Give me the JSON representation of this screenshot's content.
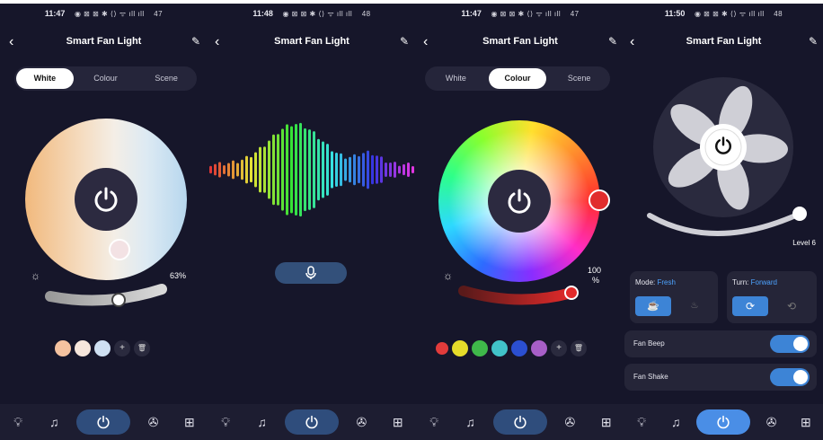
{
  "screens": [
    {
      "status_time": "11:47",
      "status_battery": "47",
      "title": "Smart Fan Light",
      "tabs": [
        "White",
        "Colour",
        "Scene"
      ],
      "active_tab": "White",
      "brightness_percent": "63%",
      "brightness_value": 0.63,
      "swatch_colors": [
        "#f4c2a0",
        "#f6e6dc",
        "#cfe0f2"
      ],
      "swatch_add": "+",
      "swatch_delete": "🗑"
    },
    {
      "status_time": "11:48",
      "status_battery": "48",
      "title": "Smart Fan Light",
      "mic_icon": "microphone-icon"
    },
    {
      "status_time": "11:47",
      "status_battery": "47",
      "title": "Smart Fan Light",
      "tabs": [
        "White",
        "Colour",
        "Scene"
      ],
      "active_tab": "Colour",
      "brightness_percent": "100",
      "brightness_unit": "%",
      "brightness_value": 1.0,
      "swatch_colors": [
        "#e23b3b",
        "#e6dc2a",
        "#3fb84a",
        "#41c3c9",
        "#2b4fd1",
        "#a75ec7"
      ],
      "swatch_add": "+",
      "swatch_delete": "🗑"
    },
    {
      "status_time": "11:50",
      "status_battery": "48",
      "title": "Smart Fan Light",
      "level_label": "Level 6",
      "mode_label": "Mode:",
      "mode_value": "Fresh",
      "turn_label": "Turn:",
      "turn_value": "Forward",
      "fan_beep_label": "Fan Beep",
      "fan_shake_label": "Fan Shake",
      "fan_beep_on": true,
      "fan_shake_on": true
    }
  ],
  "status_icons": "◉ ⊠ ⊠ ✱ ⟨⟩ ᯤ ıll ıll",
  "nav_icons": [
    "bulb-icon",
    "music-icon",
    "power-icon",
    "fan-icon",
    "grid-icon"
  ],
  "colors": {
    "bg": "#16162a",
    "accent": "#4da3ff",
    "toggle": "#3d84d6"
  }
}
